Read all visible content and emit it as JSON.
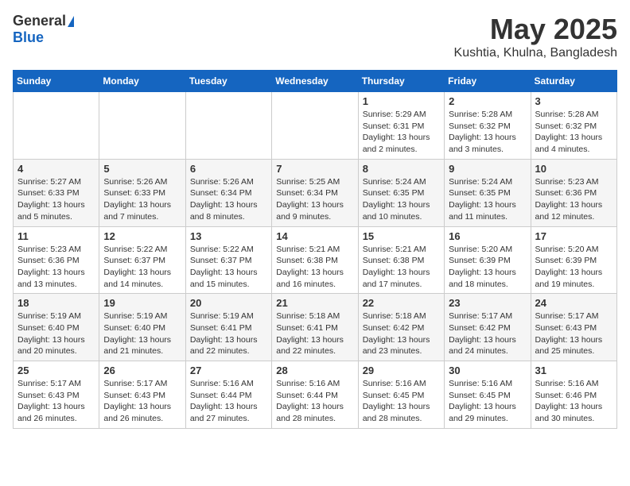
{
  "logo": {
    "general": "General",
    "blue": "Blue"
  },
  "title": {
    "month_year": "May 2025",
    "location": "Kushtia, Khulna, Bangladesh"
  },
  "headers": [
    "Sunday",
    "Monday",
    "Tuesday",
    "Wednesday",
    "Thursday",
    "Friday",
    "Saturday"
  ],
  "weeks": [
    [
      {
        "day": "",
        "info": ""
      },
      {
        "day": "",
        "info": ""
      },
      {
        "day": "",
        "info": ""
      },
      {
        "day": "",
        "info": ""
      },
      {
        "day": "1",
        "info": "Sunrise: 5:29 AM\nSunset: 6:31 PM\nDaylight: 13 hours\nand 2 minutes."
      },
      {
        "day": "2",
        "info": "Sunrise: 5:28 AM\nSunset: 6:32 PM\nDaylight: 13 hours\nand 3 minutes."
      },
      {
        "day": "3",
        "info": "Sunrise: 5:28 AM\nSunset: 6:32 PM\nDaylight: 13 hours\nand 4 minutes."
      }
    ],
    [
      {
        "day": "4",
        "info": "Sunrise: 5:27 AM\nSunset: 6:33 PM\nDaylight: 13 hours\nand 5 minutes."
      },
      {
        "day": "5",
        "info": "Sunrise: 5:26 AM\nSunset: 6:33 PM\nDaylight: 13 hours\nand 7 minutes."
      },
      {
        "day": "6",
        "info": "Sunrise: 5:26 AM\nSunset: 6:34 PM\nDaylight: 13 hours\nand 8 minutes."
      },
      {
        "day": "7",
        "info": "Sunrise: 5:25 AM\nSunset: 6:34 PM\nDaylight: 13 hours\nand 9 minutes."
      },
      {
        "day": "8",
        "info": "Sunrise: 5:24 AM\nSunset: 6:35 PM\nDaylight: 13 hours\nand 10 minutes."
      },
      {
        "day": "9",
        "info": "Sunrise: 5:24 AM\nSunset: 6:35 PM\nDaylight: 13 hours\nand 11 minutes."
      },
      {
        "day": "10",
        "info": "Sunrise: 5:23 AM\nSunset: 6:36 PM\nDaylight: 13 hours\nand 12 minutes."
      }
    ],
    [
      {
        "day": "11",
        "info": "Sunrise: 5:23 AM\nSunset: 6:36 PM\nDaylight: 13 hours\nand 13 minutes."
      },
      {
        "day": "12",
        "info": "Sunrise: 5:22 AM\nSunset: 6:37 PM\nDaylight: 13 hours\nand 14 minutes."
      },
      {
        "day": "13",
        "info": "Sunrise: 5:22 AM\nSunset: 6:37 PM\nDaylight: 13 hours\nand 15 minutes."
      },
      {
        "day": "14",
        "info": "Sunrise: 5:21 AM\nSunset: 6:38 PM\nDaylight: 13 hours\nand 16 minutes."
      },
      {
        "day": "15",
        "info": "Sunrise: 5:21 AM\nSunset: 6:38 PM\nDaylight: 13 hours\nand 17 minutes."
      },
      {
        "day": "16",
        "info": "Sunrise: 5:20 AM\nSunset: 6:39 PM\nDaylight: 13 hours\nand 18 minutes."
      },
      {
        "day": "17",
        "info": "Sunrise: 5:20 AM\nSunset: 6:39 PM\nDaylight: 13 hours\nand 19 minutes."
      }
    ],
    [
      {
        "day": "18",
        "info": "Sunrise: 5:19 AM\nSunset: 6:40 PM\nDaylight: 13 hours\nand 20 minutes."
      },
      {
        "day": "19",
        "info": "Sunrise: 5:19 AM\nSunset: 6:40 PM\nDaylight: 13 hours\nand 21 minutes."
      },
      {
        "day": "20",
        "info": "Sunrise: 5:19 AM\nSunset: 6:41 PM\nDaylight: 13 hours\nand 22 minutes."
      },
      {
        "day": "21",
        "info": "Sunrise: 5:18 AM\nSunset: 6:41 PM\nDaylight: 13 hours\nand 22 minutes."
      },
      {
        "day": "22",
        "info": "Sunrise: 5:18 AM\nSunset: 6:42 PM\nDaylight: 13 hours\nand 23 minutes."
      },
      {
        "day": "23",
        "info": "Sunrise: 5:17 AM\nSunset: 6:42 PM\nDaylight: 13 hours\nand 24 minutes."
      },
      {
        "day": "24",
        "info": "Sunrise: 5:17 AM\nSunset: 6:43 PM\nDaylight: 13 hours\nand 25 minutes."
      }
    ],
    [
      {
        "day": "25",
        "info": "Sunrise: 5:17 AM\nSunset: 6:43 PM\nDaylight: 13 hours\nand 26 minutes."
      },
      {
        "day": "26",
        "info": "Sunrise: 5:17 AM\nSunset: 6:43 PM\nDaylight: 13 hours\nand 26 minutes."
      },
      {
        "day": "27",
        "info": "Sunrise: 5:16 AM\nSunset: 6:44 PM\nDaylight: 13 hours\nand 27 minutes."
      },
      {
        "day": "28",
        "info": "Sunrise: 5:16 AM\nSunset: 6:44 PM\nDaylight: 13 hours\nand 28 minutes."
      },
      {
        "day": "29",
        "info": "Sunrise: 5:16 AM\nSunset: 6:45 PM\nDaylight: 13 hours\nand 28 minutes."
      },
      {
        "day": "30",
        "info": "Sunrise: 5:16 AM\nSunset: 6:45 PM\nDaylight: 13 hours\nand 29 minutes."
      },
      {
        "day": "31",
        "info": "Sunrise: 5:16 AM\nSunset: 6:46 PM\nDaylight: 13 hours\nand 30 minutes."
      }
    ]
  ]
}
